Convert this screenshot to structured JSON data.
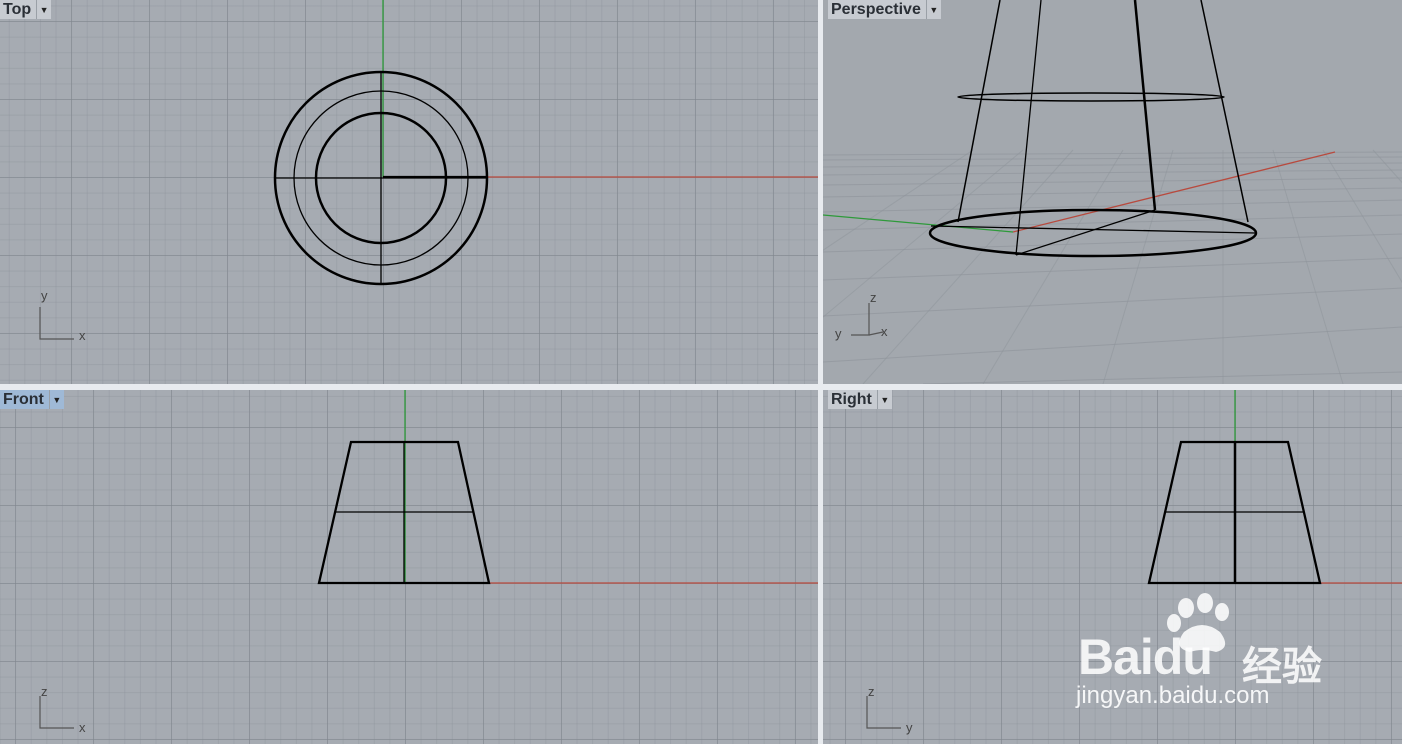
{
  "viewports": {
    "top": {
      "label": "Top",
      "axis_a": "y",
      "axis_b": "x"
    },
    "perspective": {
      "label": "Perspective",
      "axis_z": "z",
      "axis_y": "y",
      "axis_x": "x"
    },
    "front": {
      "label": "Front",
      "axis_a": "z",
      "axis_b": "x"
    },
    "right": {
      "label": "Right",
      "axis_a": "z",
      "axis_b": "y"
    }
  },
  "dropdown_icon": "chevron-down-icon",
  "colors": {
    "background": "#a6abb2",
    "x_axis": "#b84a3e",
    "y_axis": "#2e9a3a",
    "curve": "#000000",
    "active_label": "#9fb9d6"
  },
  "watermark": {
    "logo": "Baidu",
    "cn": "经验",
    "url": "jingyan.baidu.com"
  }
}
